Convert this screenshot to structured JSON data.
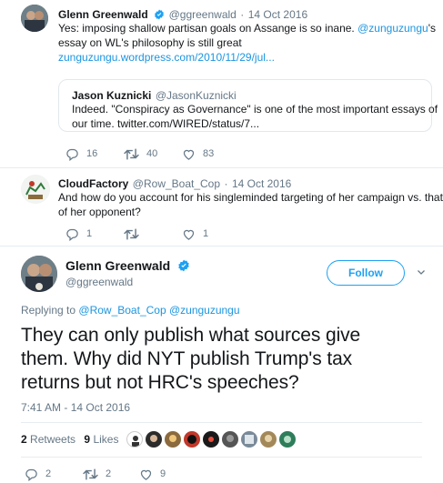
{
  "tweet1": {
    "author_name": "Glenn Greenwald",
    "handle": "@ggreenwald",
    "sep": "·",
    "date": "14 Oct 2016",
    "line1_a": "Yes: imposing shallow partisan goals on Assange is so inane.",
    "line1_mention": "@zunguzungu",
    "line1_b": "'s",
    "line2": "essay on WL's philosophy is still great",
    "line3_link": "zunguzungu.wordpress.com/2010/11/29/jul...",
    "quote": {
      "author_name": "Jason Kuznicki",
      "handle": "@JasonKuznicki",
      "line1": "Indeed. \"Conspiracy as Governance\" is one of the most important essays of",
      "line2": "our time. twitter.com/WIRED/status/7..."
    },
    "replies": "16",
    "retweets": "40",
    "likes": "83"
  },
  "tweet2": {
    "author_name": "CloudFactory",
    "handle": "@Row_Boat_Cop",
    "sep": "·",
    "date": "14 Oct 2016",
    "line1": "And how do you account for his singleminded targeting of her campaign vs. that",
    "line2": "of her opponent?",
    "replies": "1",
    "retweets": "",
    "likes": "1"
  },
  "main_tweet": {
    "author_name": "Glenn Greenwald",
    "handle": "@ggreenwald",
    "follow_label": "Follow",
    "replying_prefix": "Replying to",
    "replying_to": "@Row_Boat_Cop @zunguzungu",
    "line1": "They can only publish what sources give",
    "line2": "them. Why did NYT publish Trump's tax",
    "line3": "returns but not HRC's speeches?",
    "timestamp": "7:41 AM - 14 Oct 2016",
    "retweet_count": "2",
    "retweet_label": "Retweets",
    "like_count": "9",
    "like_label": "Likes",
    "replies": "2",
    "retweets": "2",
    "likes": "9"
  },
  "colors": {
    "accent": "#1da1f2",
    "link": "#1b95e0",
    "muted": "#657786",
    "verified": "#1da1f2"
  }
}
